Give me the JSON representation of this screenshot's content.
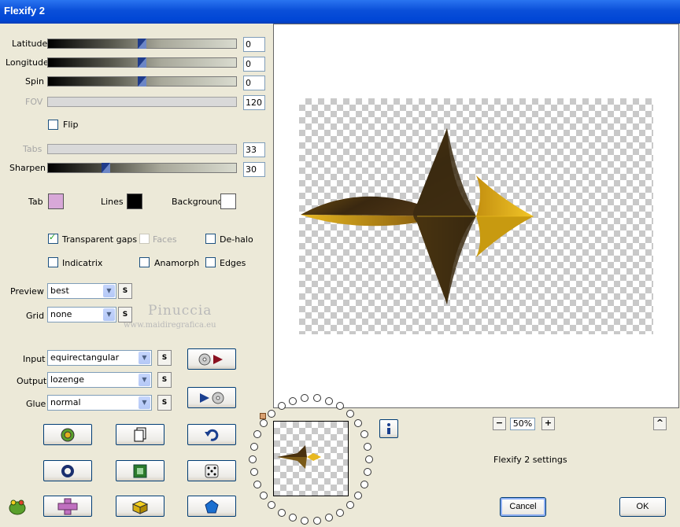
{
  "window": {
    "title": "Flexify 2"
  },
  "sliders": [
    {
      "label": "Latitude",
      "value": "0",
      "level": 0.5,
      "enabled": true
    },
    {
      "label": "Longitude",
      "value": "0",
      "level": 0.5,
      "enabled": true
    },
    {
      "label": "Spin",
      "value": "0",
      "level": 0.5,
      "enabled": true
    },
    {
      "label": "FOV",
      "value": "120",
      "enabled": false
    },
    {
      "label": "Tabs",
      "value": "33",
      "enabled": false
    },
    {
      "label": "Sharpen",
      "value": "30",
      "level": 0.3,
      "enabled": true
    }
  ],
  "flip": {
    "label": "Flip",
    "checked": false
  },
  "colors": {
    "tab": {
      "label": "Tab",
      "color": "#d8a8d8"
    },
    "lines": {
      "label": "Lines",
      "color": "#000000"
    },
    "background": {
      "label": "Background",
      "color": "#ffffff"
    }
  },
  "options": {
    "transparent_gaps": {
      "label": "Transparent gaps",
      "checked": true
    },
    "faces": {
      "label": "Faces",
      "checked": false
    },
    "dehalo": {
      "label": "De-halo",
      "checked": false
    },
    "indicatrix": {
      "label": "Indicatrix",
      "checked": false
    },
    "anamorph": {
      "label": "Anamorph",
      "checked": false
    },
    "edges": {
      "label": "Edges",
      "checked": false
    }
  },
  "preview_select": {
    "label": "Preview",
    "value": "best"
  },
  "grid_select": {
    "label": "Grid",
    "value": "none"
  },
  "watermark": {
    "name": "Pinuccia",
    "url": "www.maidiregrafica.eu"
  },
  "input_select": {
    "label": "Input",
    "value": "equirectangular"
  },
  "output_select": {
    "label": "Output",
    "value": "lozenge"
  },
  "glue_select": {
    "label": "Glue",
    "value": "normal"
  },
  "s_button_label": "S",
  "zoom": {
    "value": "50%",
    "minus": "−",
    "plus": "+"
  },
  "up_label": "^",
  "status_text": "Flexify 2 settings",
  "buttons": {
    "cancel": "Cancel",
    "ok": "OK"
  },
  "icons": {
    "info": "info-icon",
    "run_forward": "cd-play-icon",
    "run_back": "play-cd-icon",
    "settings": "gear-icon",
    "copy": "copy-page-icon",
    "undo": "undo-icon",
    "ring": "ring-icon",
    "square": "green-square-icon",
    "dice": "dice-icon",
    "cross": "purple-cross-icon",
    "cube": "yellow-cube-icon",
    "pentagon": "blue-pentagon-icon",
    "frog": "frog-logo-icon"
  },
  "accent_colors": {
    "title_blue": "#0a4fd9",
    "gold": "#d8a818",
    "dark_gold": "#3b2a10"
  }
}
